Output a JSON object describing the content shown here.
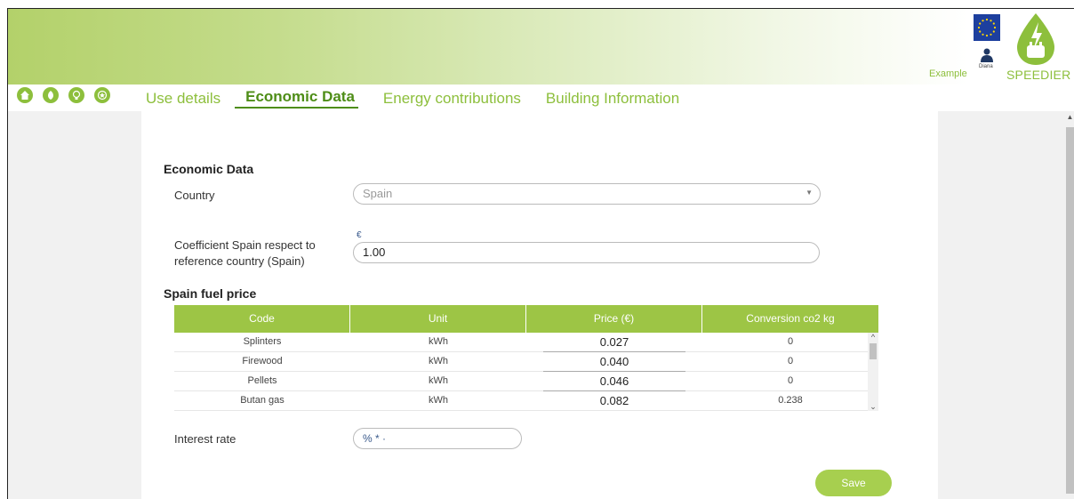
{
  "header": {
    "example_label": "Example",
    "user_name": "Diana",
    "logo_text": "SPEEDIER",
    "brand_color": "#8dbf3c"
  },
  "nav": {
    "icons": [
      "home-icon",
      "leaf-icon",
      "bulb-icon",
      "star-icon"
    ],
    "tabs": [
      {
        "label": "Use details"
      },
      {
        "label": "Economic Data"
      },
      {
        "label": "Energy contributions"
      },
      {
        "label": "Building Information"
      }
    ],
    "active_tab": "Economic Data"
  },
  "main": {
    "section_title": "Economic Data",
    "country_label": "Country",
    "country_value": "Spain",
    "coefficient_label_line1": "Coefficient Spain respect to",
    "coefficient_label_line2": "reference country (Spain)",
    "currency_symbol": "€",
    "coefficient_value": "1.00",
    "fuel_title": "Spain fuel price",
    "table": {
      "headers": [
        "Code",
        "Unit",
        "Price (€)",
        "Conversion co2 kg"
      ],
      "rows": [
        {
          "code": "Splinters",
          "unit": "kWh",
          "price": "0.027",
          "co2": "0"
        },
        {
          "code": "Firewood",
          "unit": "kWh",
          "price": "0.040",
          "co2": "0"
        },
        {
          "code": "Pellets",
          "unit": "kWh",
          "price": "0.046",
          "co2": "0"
        },
        {
          "code": "Butan gas",
          "unit": "kWh",
          "price": "0.082",
          "co2": "0.238"
        }
      ]
    },
    "interest_label": "Interest rate",
    "interest_placeholder": "% * ·",
    "save_label": "Save"
  }
}
